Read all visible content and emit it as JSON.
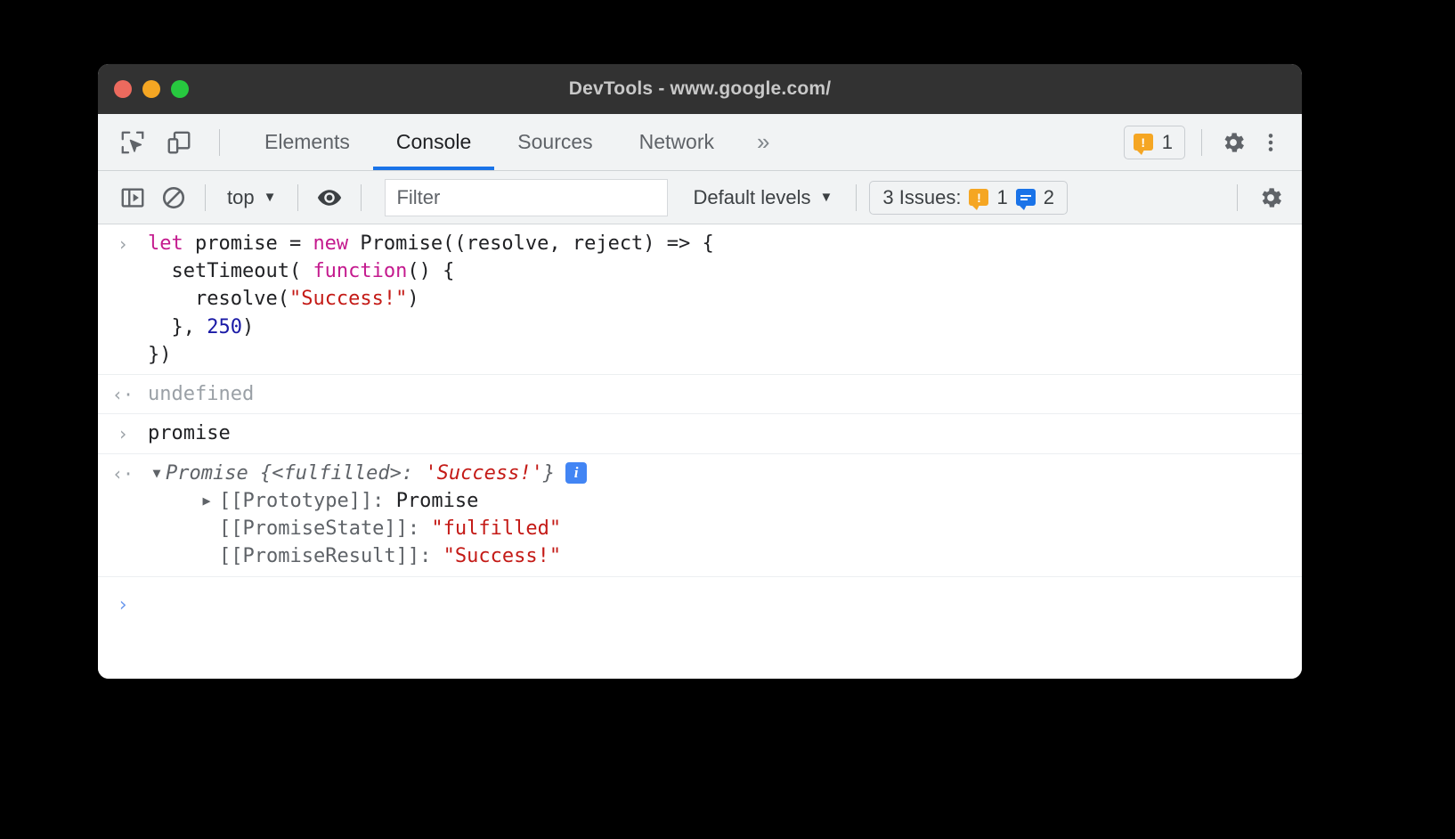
{
  "window": {
    "title": "DevTools - www.google.com/",
    "traffic_lights": [
      "close",
      "minimize",
      "zoom"
    ],
    "colors": {
      "titlebar_bg": "#323232",
      "close": "#ec6a5e",
      "minimize": "#f5a623",
      "zoom": "#27c93f",
      "accent": "#1a73e8",
      "warning": "#f5a623",
      "info": "#1a73e8",
      "string": "#c41a16",
      "keyword": "#c41a8e",
      "number": "#1a1aa6"
    }
  },
  "tabbar": {
    "inspect_icon": "inspect-element-icon",
    "device_icon": "device-toolbar-icon",
    "tabs": [
      {
        "label": "Elements",
        "active": false
      },
      {
        "label": "Console",
        "active": true
      },
      {
        "label": "Sources",
        "active": false
      },
      {
        "label": "Network",
        "active": false
      }
    ],
    "more_tabs_label": "»",
    "warning_count": "1",
    "settings_icon": "gear-icon",
    "more_options_icon": "kebab-menu-icon"
  },
  "console_toolbar": {
    "sidebar_toggle_icon": "console-sidebar-icon",
    "clear_icon": "clear-console-icon",
    "context_label": "top",
    "context_caret": "▼",
    "eye_icon": "live-expression-eye-icon",
    "filter_placeholder": "Filter",
    "filter_value": "",
    "levels_label": "Default levels",
    "levels_caret": "▼",
    "issues_label": "3 Issues:",
    "issues_warning_count": "1",
    "issues_info_count": "2",
    "settings_icon": "console-settings-gear-icon"
  },
  "console": {
    "entries": [
      {
        "type": "input",
        "gutter": "›",
        "lines": [
          [
            {
              "t": "let ",
              "c": "kw"
            },
            {
              "t": "promise = ",
              "c": "plain"
            },
            {
              "t": "new ",
              "c": "kw"
            },
            {
              "t": "Promise((resolve, reject) => {",
              "c": "plain"
            }
          ],
          [
            {
              "t": "  setTimeout( ",
              "c": "plain"
            },
            {
              "t": "function",
              "c": "kw"
            },
            {
              "t": "() {",
              "c": "plain"
            }
          ],
          [
            {
              "t": "    resolve(",
              "c": "plain"
            },
            {
              "t": "\"Success!\"",
              "c": "str"
            },
            {
              "t": ")",
              "c": "plain"
            }
          ],
          [
            {
              "t": "  }, ",
              "c": "plain"
            },
            {
              "t": "250",
              "c": "num"
            },
            {
              "t": ")",
              "c": "plain"
            }
          ],
          [
            {
              "t": "})",
              "c": "plain"
            }
          ]
        ]
      },
      {
        "type": "output",
        "gutter": "‹·",
        "text": "undefined",
        "style": "dim"
      },
      {
        "type": "input",
        "gutter": "›",
        "lines": [
          [
            {
              "t": "promise",
              "c": "plain"
            }
          ]
        ]
      },
      {
        "type": "object",
        "gutter": "‹·",
        "triangle": "▼",
        "preview_parts": [
          {
            "t": "Promise {",
            "c": "gray"
          },
          {
            "t": "<fulfilled>",
            "c": "gray"
          },
          {
            "t": ": ",
            "c": "gray"
          },
          {
            "t": "'Success!'",
            "c": "str"
          },
          {
            "t": "}",
            "c": "gray"
          }
        ],
        "badge": "info-badge",
        "badge_glyph": "i",
        "properties": [
          {
            "triangle": "▶",
            "expanded": false,
            "key": "[[Prototype]]",
            "sep": ": ",
            "value": "Promise",
            "value_style": "plain"
          },
          {
            "triangle": "",
            "expanded": false,
            "key": "[[PromiseState]]",
            "sep": ": ",
            "value": "\"fulfilled\"",
            "value_style": "str"
          },
          {
            "triangle": "",
            "expanded": false,
            "key": "[[PromiseResult]]",
            "sep": ": ",
            "value": "\"Success!\"",
            "value_style": "str"
          }
        ]
      },
      {
        "type": "prompt",
        "gutter": "›",
        "value": ""
      }
    ]
  }
}
